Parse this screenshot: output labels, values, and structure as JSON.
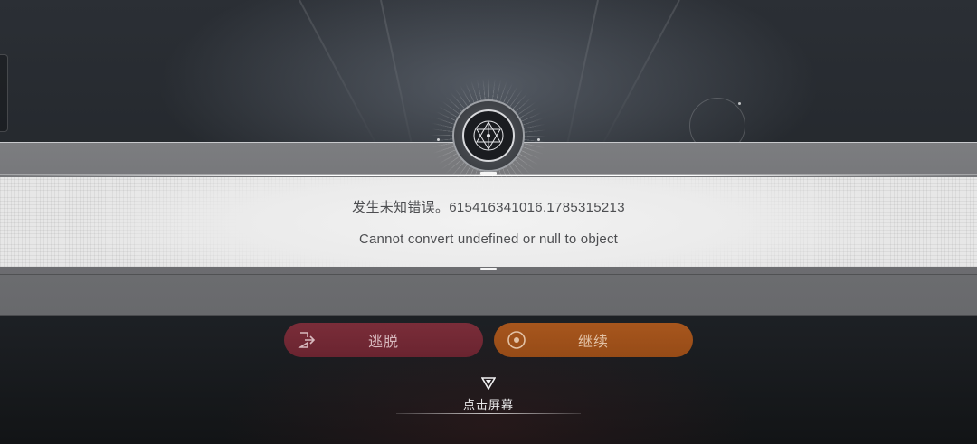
{
  "dialog": {
    "error_title": "发生未知错误。615416341016.1785315213",
    "error_message": "Cannot convert undefined or null to object"
  },
  "buttons": {
    "escape_label": "逃脱",
    "continue_label": "继续"
  },
  "hint": {
    "tap_label": "点击屏幕"
  },
  "colors": {
    "escape_button": "#7a2d39",
    "continue_button": "#a7561d",
    "card_background": "#e7e7e7",
    "modal_band": "#727376"
  },
  "icons": {
    "emblem": "constellation-emblem-icon",
    "escape": "exit-door-icon",
    "continue": "target-circle-icon",
    "tap": "down-triangle-icon"
  }
}
